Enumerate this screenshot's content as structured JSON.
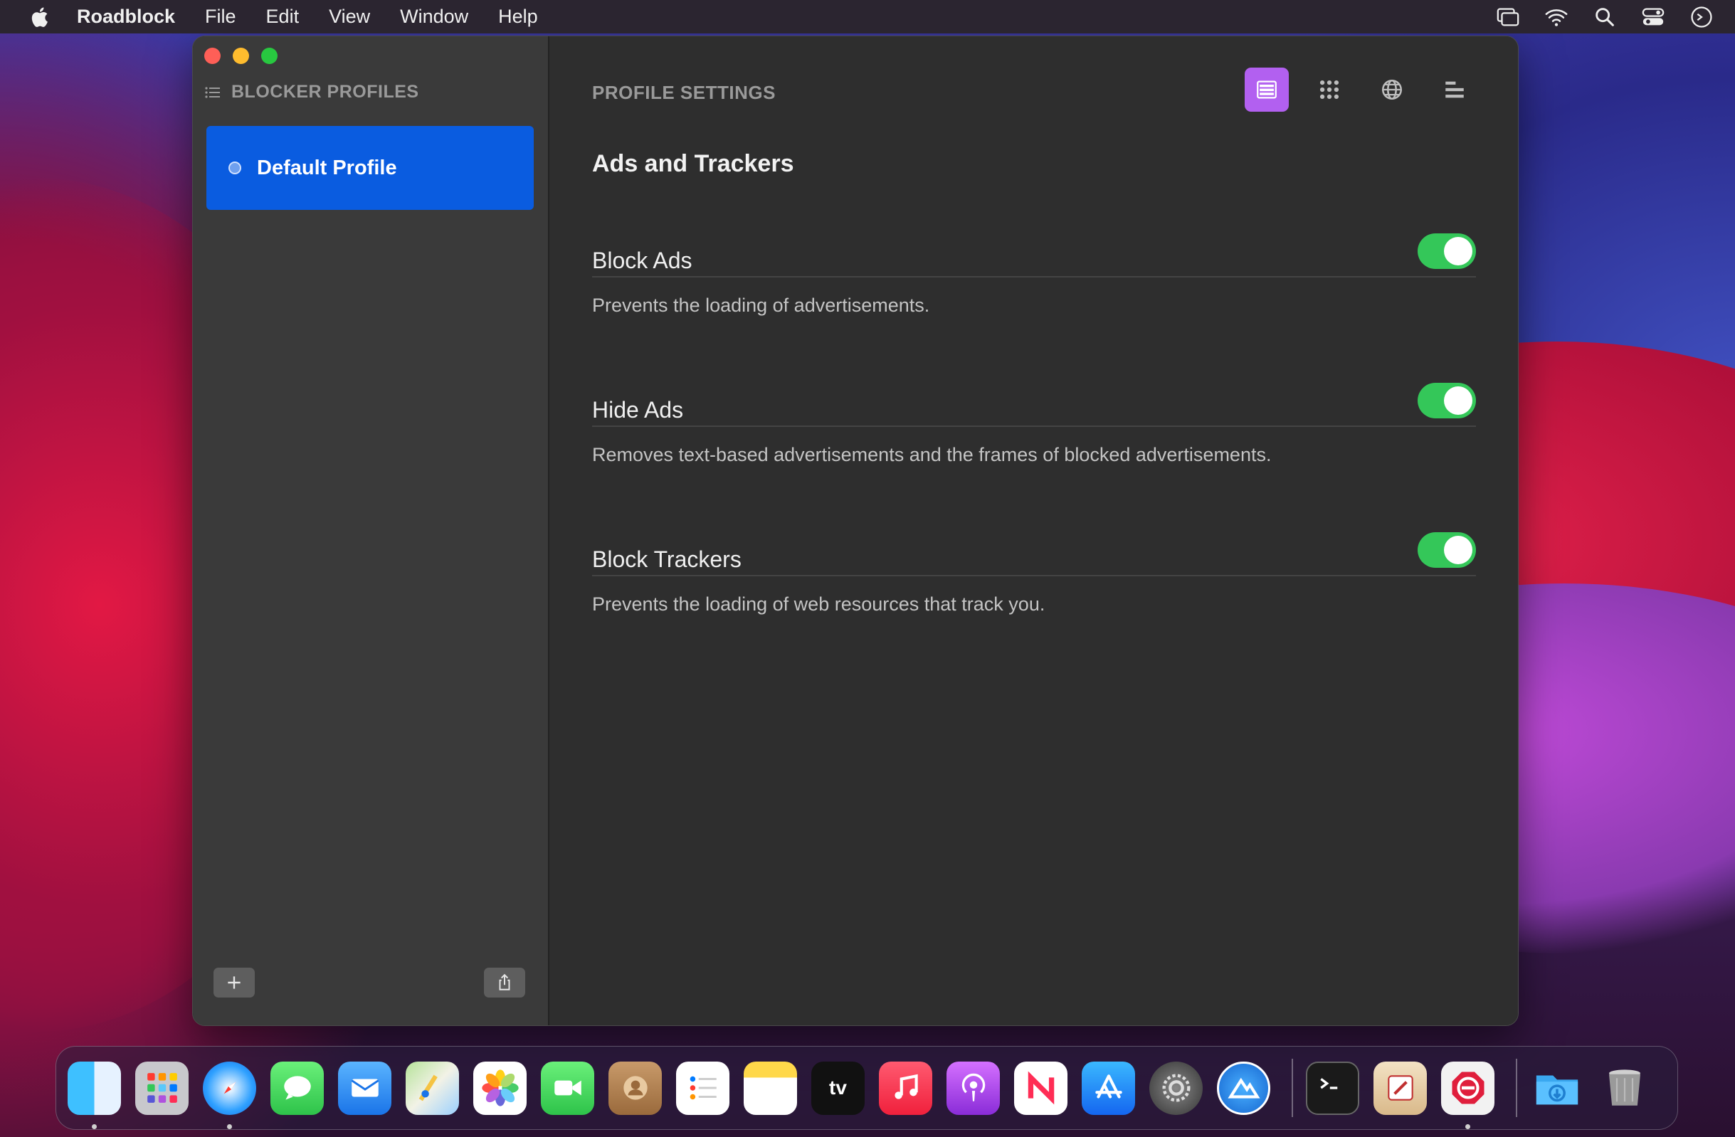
{
  "menubar": {
    "app_name": "Roadblock",
    "items": [
      "File",
      "Edit",
      "View",
      "Window",
      "Help"
    ]
  },
  "sidebar": {
    "header": "BLOCKER PROFILES",
    "profiles": [
      {
        "label": "Default Profile",
        "selected": true
      }
    ]
  },
  "content": {
    "header": "PROFILE SETTINGS",
    "section_title": "Ads and Trackers",
    "settings": [
      {
        "label": "Block Ads",
        "description": "Prevents the loading of advertisements.",
        "enabled": true
      },
      {
        "label": "Hide Ads",
        "description": "Removes text-based advertisements and the frames of blocked advertisements.",
        "enabled": true
      },
      {
        "label": "Block Trackers",
        "description": "Prevents the loading of web resources that track you.",
        "enabled": true
      }
    ],
    "toolbar_icons": [
      "list-view-icon",
      "grid-icon",
      "globe-icon",
      "align-left-icon"
    ]
  },
  "colors": {
    "accent": "#0a5ce0",
    "toolbar_active": "#b260f0",
    "toggle_on": "#34c759"
  },
  "dock": {
    "apps": [
      "finder",
      "launchpad",
      "safari",
      "messages",
      "mail",
      "maps",
      "photos",
      "facetime",
      "contacts",
      "reminders",
      "notes",
      "tv",
      "music",
      "podcasts",
      "news",
      "app-store",
      "system-preferences",
      "altimeter",
      "terminal",
      "script-editor",
      "roadblock",
      "downloads",
      "trash"
    ],
    "tv_label": "tv"
  }
}
